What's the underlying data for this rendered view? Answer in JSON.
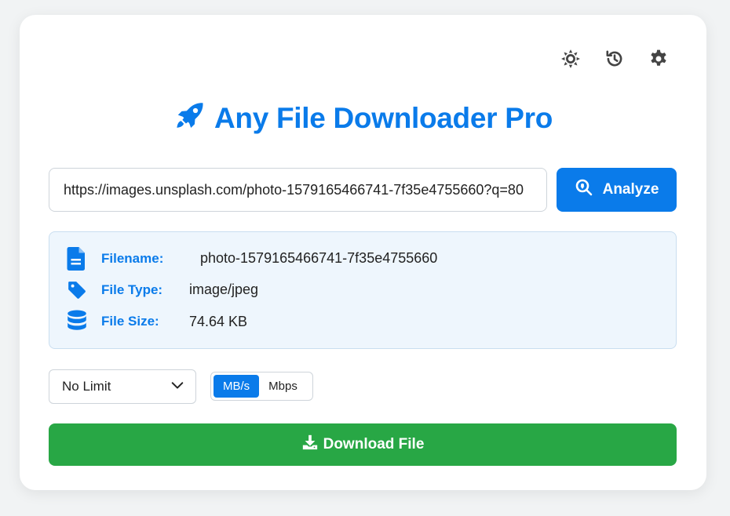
{
  "header": {
    "title": "Any File Downloader Pro",
    "icons": [
      "theme-icon",
      "history-icon",
      "settings-icon"
    ]
  },
  "url_input": {
    "value": "https://images.unsplash.com/photo-1579165466741-7f35e4755660?q=80"
  },
  "analyze_button": {
    "label": "Analyze"
  },
  "file_info": {
    "filename_label": "Filename:",
    "filename_value": "photo-1579165466741-7f35e4755660",
    "filetype_label": "File Type:",
    "filetype_value": "image/jpeg",
    "filesize_label": "File Size:",
    "filesize_value": "74.64 KB"
  },
  "speed_limit": {
    "selected": "No Limit"
  },
  "unit_toggle": {
    "options": [
      "MB/s",
      "Mbps"
    ],
    "active": "MB/s"
  },
  "download_button": {
    "label": "Download File"
  },
  "colors": {
    "primary": "#0a7bea",
    "success": "#28a745",
    "info_bg": "#eef6fd",
    "icon_dark": "#444444"
  }
}
